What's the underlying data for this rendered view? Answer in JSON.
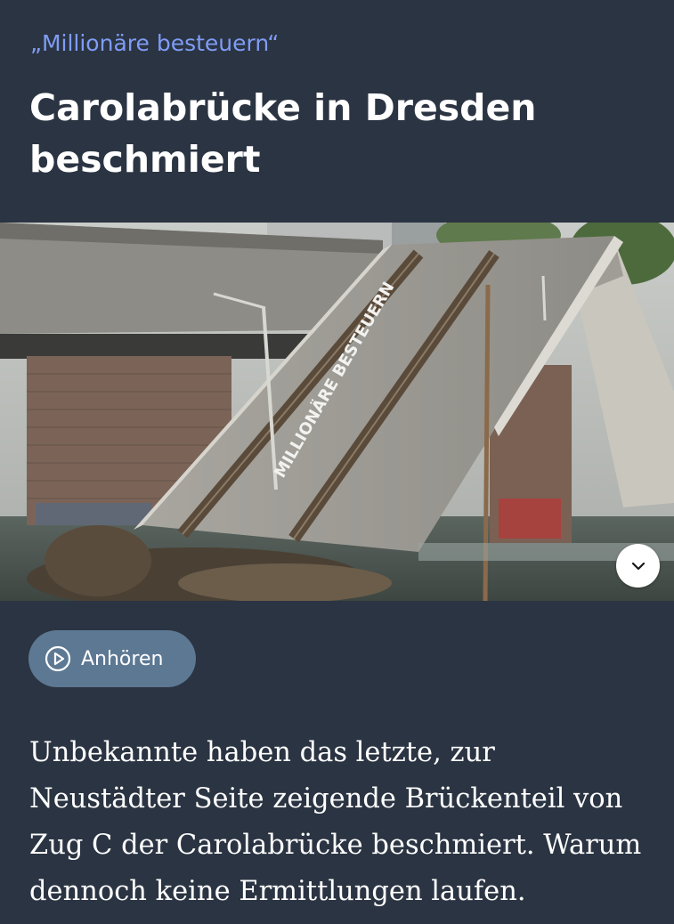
{
  "article": {
    "kicker": "„Millionäre besteuern“",
    "headline": "Carolabrücke in Dresden beschmiert",
    "teaser": "Unbekannte haben das letzte, zur Neustädter Seite zeigende Brückenteil von Zug C der Carolabrücke beschmiert. Warum dennoch keine Ermittlungen laufen."
  },
  "image": {
    "graffiti_text": "MILLIONÄRE BESTEUERN",
    "expand_icon": "chevron-down-icon"
  },
  "audio": {
    "listen_label": "Anhören",
    "icon": "play-circle-icon"
  },
  "colors": {
    "background": "#2b3442",
    "kicker": "#7f9cf5",
    "listen_button": "#5d7893",
    "text": "#ffffff"
  }
}
